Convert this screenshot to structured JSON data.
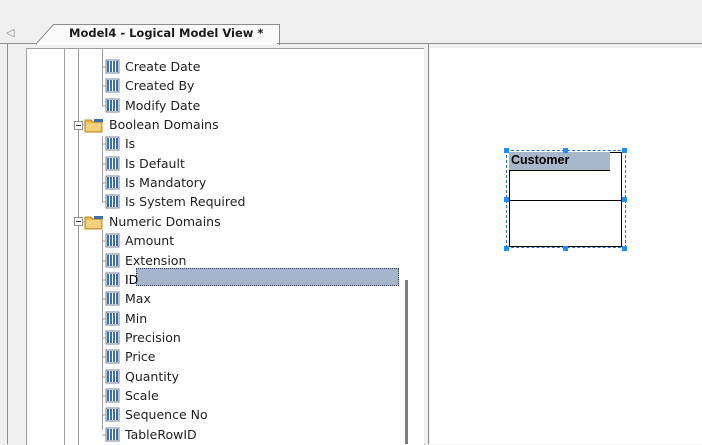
{
  "tab": {
    "title": "Model4 - Logical Model View *"
  },
  "tree": {
    "items": [
      {
        "label": "Create Date",
        "type": "attribute"
      },
      {
        "label": "Created By",
        "type": "attribute"
      },
      {
        "label": "Modify Date",
        "type": "attribute"
      },
      {
        "label": "Boolean Domains",
        "type": "folder"
      },
      {
        "label": "Is",
        "type": "attribute"
      },
      {
        "label": "Is Default",
        "type": "attribute"
      },
      {
        "label": "Is Mandatory",
        "type": "attribute"
      },
      {
        "label": "Is System Required",
        "type": "attribute"
      },
      {
        "label": "Numeric Domains",
        "type": "folder"
      },
      {
        "label": "Amount",
        "type": "attribute"
      },
      {
        "label": "Extension",
        "type": "attribute"
      },
      {
        "label": "ID",
        "type": "attribute",
        "selected": true
      },
      {
        "label": "Max",
        "type": "attribute"
      },
      {
        "label": "Min",
        "type": "attribute"
      },
      {
        "label": "Precision",
        "type": "attribute"
      },
      {
        "label": "Price",
        "type": "attribute"
      },
      {
        "label": "Quantity",
        "type": "attribute"
      },
      {
        "label": "Scale",
        "type": "attribute"
      },
      {
        "label": "Sequence No",
        "type": "attribute"
      },
      {
        "label": "TableRowID",
        "type": "attribute"
      }
    ]
  },
  "diagram": {
    "entity_name": "Customer"
  },
  "colors": {
    "selection": "#a5b6cc",
    "entity_header": "#a7b8cb",
    "handle": "#1e90ff"
  }
}
